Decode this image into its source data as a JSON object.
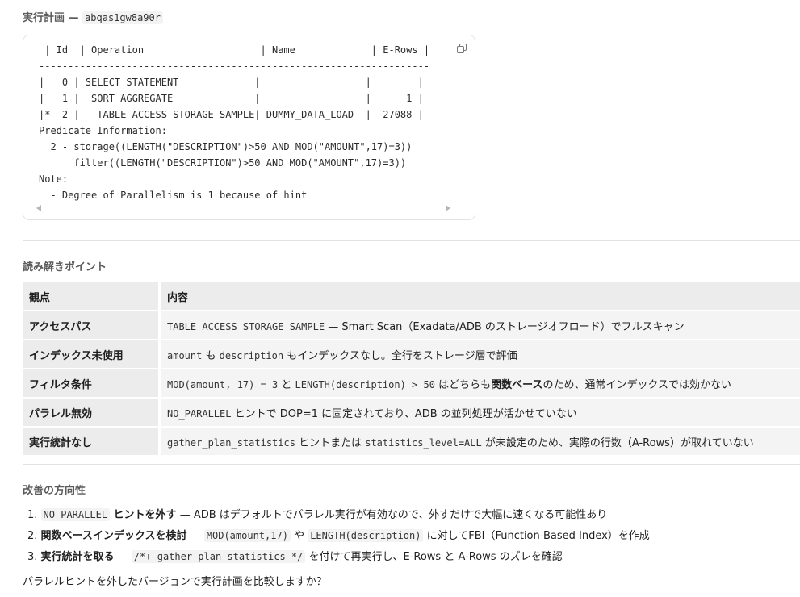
{
  "plan": {
    "title_prefix": "実行計画 —",
    "sql_id": "abqas1gw8a90r",
    "text": " | Id  | Operation                    | Name             | E-Rows |\n-------------------------------------------------------------------\n|   0 | SELECT STATEMENT             |                  |        |\n|   1 |  SORT AGGREGATE              |                  |      1 |\n|*  2 |   TABLE ACCESS STORAGE SAMPLE| DUMMY_DATA_LOAD  |  27088 |\nPredicate Information:\n  2 - storage((LENGTH(\"DESCRIPTION\")>50 AND MOD(\"AMOUNT\",17)=3))\n      filter((LENGTH(\"DESCRIPTION\")>50 AND MOD(\"AMOUNT\",17)=3))\nNote:\n  - Degree of Parallelism is 1 because of hint",
    "copy_icon": "copy-icon"
  },
  "points": {
    "title": "読み解きポイント",
    "headers": [
      "観点",
      "内容"
    ],
    "rows": [
      {
        "k": "アクセスパス",
        "c1": "TABLE ACCESS STORAGE SAMPLE",
        "t1": " — Smart Scan（Exadata/ADB のストレージオフロード）でフルスキャン"
      },
      {
        "k": "インデックス未使用",
        "c1": "amount",
        "t1": " も ",
        "c2": "description",
        "t2": " もインデックスなし。全行をストレージ層で評価"
      },
      {
        "k": "フィルタ条件",
        "c1": "MOD(amount, 17) = 3",
        "t1": " と ",
        "c2": "LENGTH(description) > 50",
        "t2": " はどちらも",
        "b": "関数ベース",
        "t3": "のため、通常インデックスでは効かない"
      },
      {
        "k": "パラレル無効",
        "c1": "NO_PARALLEL",
        "t1": " ヒントで DOP=1 に固定されており、ADB の並列処理が活かせていない"
      },
      {
        "k": "実行統計なし",
        "c1": "gather_plan_statistics",
        "t1": " ヒントまたは ",
        "c2": "statistics_level=ALL",
        "t2": " が未設定のため、実際の行数（A-Rows）が取れていない"
      }
    ]
  },
  "improve": {
    "title": "改善の方向性",
    "items": [
      {
        "num": "1.",
        "c0": "NO_PARALLEL",
        "b": " ヒントを外す",
        "t1": " — ADB はデフォルトでパラレル実行が有効なので、外すだけで大幅に速くなる可能性あり"
      },
      {
        "num": "2.",
        "b": "関数ベースインデックスを検討",
        "t1": " — ",
        "c1": "MOD(amount,17)",
        "t2": " や ",
        "c2": "LENGTH(description)",
        "t3": " に対してFBI（Function-Based Index）を作成"
      },
      {
        "num": "3.",
        "b": "実行統計を取る",
        "t1": " — ",
        "c1": "/*+ gather_plan_statistics */",
        "t2": " を付けて再実行し、E-Rows と A-Rows のズレを確認"
      }
    ]
  },
  "final_question": "パラレルヒントを外したバージョンで実行計画を比較しますか？"
}
